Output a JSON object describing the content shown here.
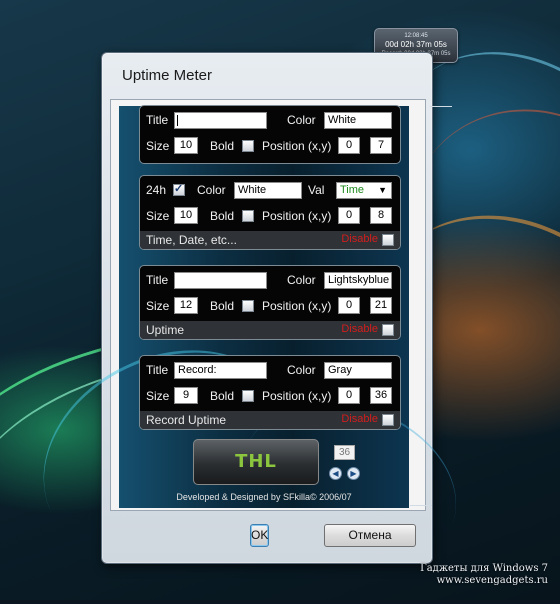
{
  "desktop": {
    "gadget_clock": {
      "time": "12:08:45",
      "uptime": "00d 02h 37m 05s",
      "record": "Record: 00d 02h 37m 05s"
    },
    "watermark_line1": "Гаджеты для Windows 7",
    "watermark_line2": "www.sevengadgets.ru"
  },
  "window": {
    "title": "Uptime Meter",
    "ok_label": "OK",
    "cancel_label": "Отмена"
  },
  "labels": {
    "title": "Title",
    "color": "Color",
    "size": "Size",
    "bold": "Bold",
    "position": "Position (x,y)",
    "disable": "Disable",
    "h24": "24h",
    "val": "Val"
  },
  "panels": [
    {
      "title_value": "",
      "color_value": "White",
      "size_value": "10",
      "bold": false,
      "pos_x": "0",
      "pos_y": "7"
    },
    {
      "h24_checked": true,
      "color_value": "White",
      "val_value": "Time",
      "size_value": "10",
      "bold": false,
      "pos_x": "0",
      "pos_y": "8",
      "footer": "Time, Date, etc...",
      "disabled": false
    },
    {
      "title_value": "",
      "color_value": "Lightskyblue",
      "size_value": "12",
      "bold": false,
      "pos_x": "0",
      "pos_y": "21",
      "footer": "Uptime",
      "disabled": false
    },
    {
      "title_value": "Record:",
      "color_value": "Gray",
      "size_value": "9",
      "bold": false,
      "pos_x": "0",
      "pos_y": "36",
      "footer": "Record Uptime",
      "disabled": false
    }
  ],
  "logo_text": "THL",
  "counter_value": "36",
  "credit": "Developed & Designed by SFkilla© 2006/07",
  "colors": {
    "disable_red": "#d31d1d",
    "val_green": "#1d8a1d",
    "logo_green": "#8cc63e"
  }
}
